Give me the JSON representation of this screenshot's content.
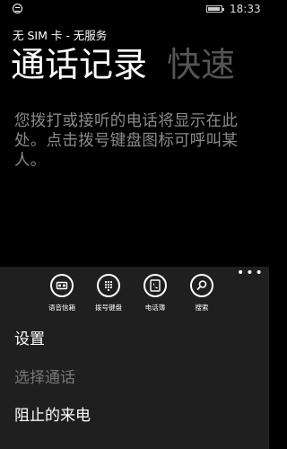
{
  "status_bar": {
    "time": "18:33"
  },
  "header": {
    "carrier": "无 SIM 卡 - 无服务",
    "tabs": [
      {
        "label": "通话记录",
        "active": true
      },
      {
        "label": "快速",
        "active": false
      }
    ]
  },
  "main": {
    "empty_message": "您拨打或接听的电话将显示在此处。点击拨号键盘图标可呼叫某人。"
  },
  "app_bar": {
    "more": "•••",
    "buttons": [
      {
        "label": "语音信箱",
        "icon": "voicemail-icon"
      },
      {
        "label": "拨号键盘",
        "icon": "keypad-icon"
      },
      {
        "label": "电话簿",
        "icon": "phonebook-icon"
      },
      {
        "label": "搜索",
        "icon": "search-icon"
      }
    ],
    "menu_items": [
      {
        "label": "设置",
        "enabled": true
      },
      {
        "label": "选择通话",
        "enabled": false
      },
      {
        "label": "阻止的来电",
        "enabled": true
      }
    ]
  }
}
